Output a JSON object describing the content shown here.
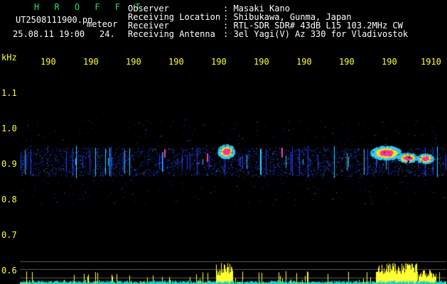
{
  "brand": "H R O F F T",
  "file": {
    "name": "UT2508111900.pn",
    "tag": "meteor",
    "date_time": "25.08.11 19:00",
    "value": "24."
  },
  "info": {
    "labels": [
      "Observer",
      "Receiving Location",
      "Receiver",
      "Receiving Antenna"
    ],
    "values": [
      ": Masaki Kano",
      ": Shibukawa, Gunma, Japan",
      ": RTL-SDR SDR# 43dB L15 103.2MHz CW",
      ": 3el Yagi(V) Az 330 for Vladivostok"
    ]
  },
  "axis": {
    "unit": "kHz",
    "x_ticks": [
      "190",
      "190",
      "190",
      "190",
      "190",
      "190",
      "190",
      "190",
      "190",
      "1910"
    ],
    "y_ticks": [
      "1.1",
      "1.0",
      "0.9",
      "0.8",
      "0.7",
      "0.6"
    ]
  },
  "colors": {
    "background": "#000000",
    "text": "#ffffff",
    "tick": "#ffff33",
    "brand": "#2ee05a",
    "noise": "#1e3cff",
    "echo_core": "#ff3c9a",
    "echo_edge": "#ffdf2a",
    "level_bar": "#ffff33",
    "level_base": "#20d0c0"
  }
}
